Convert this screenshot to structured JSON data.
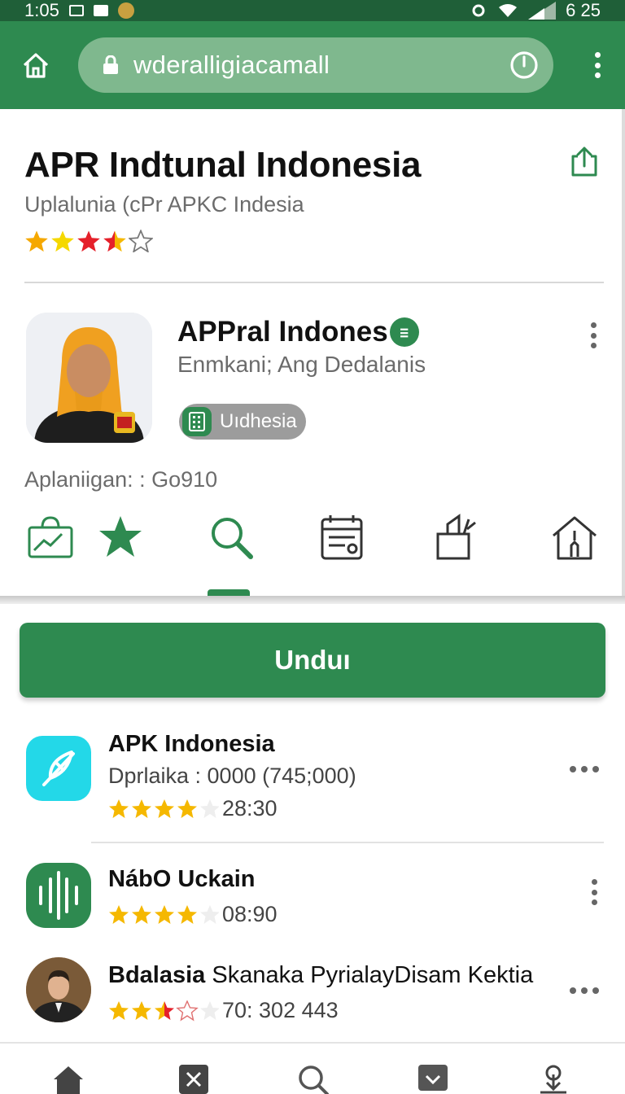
{
  "status_bar": {
    "time": "1:05",
    "right_time": "6 25"
  },
  "browser": {
    "url": "wderalligiacamall"
  },
  "header": {
    "title": "APR Indtunal Indonesia",
    "subtitle": "Uplalunia (cPr APKC Indesia",
    "rating": 3.5
  },
  "profile": {
    "name": "APPral Indones",
    "verified_badge": "ⲷ",
    "subtitle": "Enmkani; Ang Dedalanis",
    "chip_label": "Uıdhesia"
  },
  "aplan_label": "Aplaniigan: : Go910",
  "icon_row": [
    "chart-bag-icon",
    "star-icon",
    "search-icon",
    "calendar-icon",
    "bucket-icon",
    "house-icon"
  ],
  "download_label": "Unduı",
  "list": [
    {
      "title": "APK Indonesia",
      "title_rest": "",
      "subtitle": "Dprlaika : 0000 (745;000)",
      "rating_value": "28:30",
      "stars": 4,
      "icon": "feather-icon",
      "icon_color": "#23d8e8"
    },
    {
      "title": "NábO Uckain",
      "title_rest": "",
      "subtitle": "",
      "rating_value": "08:90",
      "stars": 4,
      "icon": "sound-wave-icon",
      "icon_color": "#2e8a50"
    },
    {
      "title": "Bdalasia",
      "title_rest": " Skanaka PyrialayDisam Kektia",
      "subtitle": "",
      "rating_value": "70: 302 443",
      "stars": 2.5,
      "icon": "person-avatar",
      "icon_color": "#6e5a3c"
    }
  ],
  "colors": {
    "primary": "#2e8a50",
    "status_bar": "#1f5f38",
    "star": "#f5b800",
    "star_red": "#e5202a"
  },
  "bottom_nav": [
    "home-icon",
    "close-box-icon",
    "search-icon",
    "check-box-icon",
    "download-icon"
  ]
}
